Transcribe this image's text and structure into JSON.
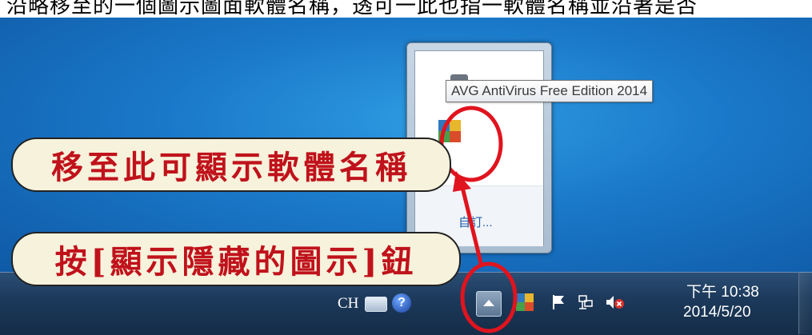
{
  "header_fragment": "沿略移至的一個圖示圖面軟體名稱，透可一此也指一軟體名稱並沿著是否",
  "popup": {
    "customize_label": "自訂..."
  },
  "tooltip": {
    "text": "AVG AntiVirus Free Edition 2014"
  },
  "annotations": {
    "callout_hover": "移至此可顯示軟體名稱",
    "callout_button": "按[顯示隱藏的圖示]鈕",
    "highlight_color": "#e0141e",
    "text_color": "#c0121b"
  },
  "taskbar": {
    "language": "CH",
    "help_glyph": "?",
    "icons": [
      "keyboard-icon",
      "help-icon",
      "show-hidden-icons-icon",
      "avg-icon",
      "action-center-flag-icon",
      "network-icon",
      "volume-muted-icon"
    ],
    "clock": {
      "time": "下午 10:38",
      "date": "2014/5/20"
    }
  }
}
